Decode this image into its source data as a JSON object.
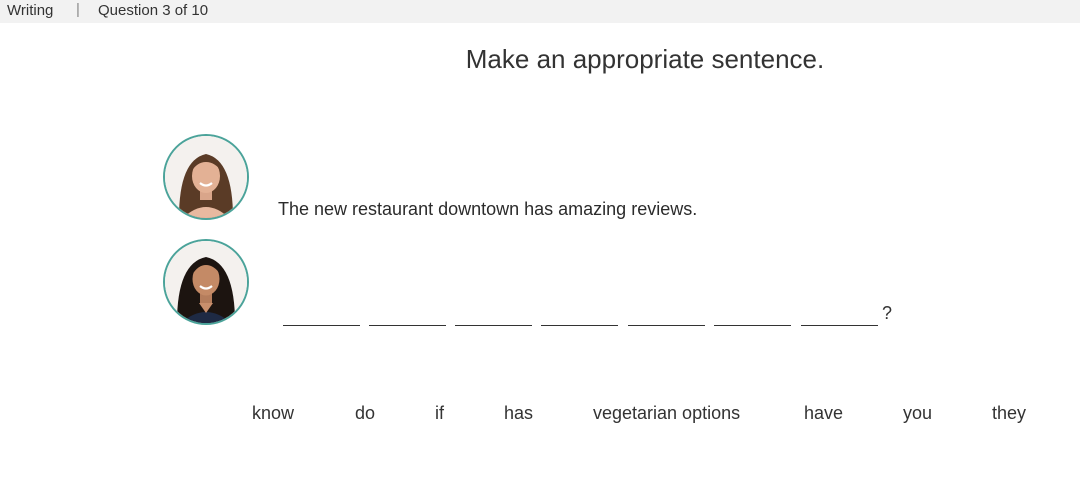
{
  "header": {
    "section": "Writing",
    "separator": "|",
    "progress": "Question 3 of 10"
  },
  "instruction": "Make an appropriate sentence.",
  "dialogue": {
    "speaker_1_line": "The new restaurant downtown has amazing reviews.",
    "answer_blank_count": 7,
    "answer_end_punct": "?"
  },
  "word_bank": [
    "know",
    "do",
    "if",
    "has",
    "vegetarian options",
    "have",
    "you",
    "they"
  ],
  "colors": {
    "avatar_ring": "#4ba39a",
    "header_bg": "#f2f2f2"
  }
}
